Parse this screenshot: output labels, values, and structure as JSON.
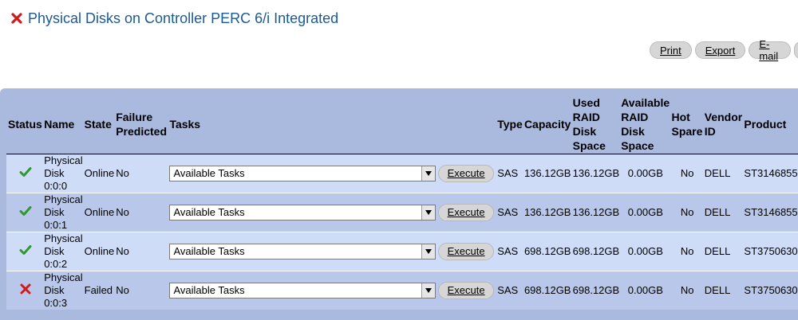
{
  "header": {
    "title": "Physical Disks on Controller PERC 6/i Integrated",
    "status_icon": "critical-x-icon"
  },
  "actions": {
    "print": "Print",
    "export": "Export",
    "email": "E-mail"
  },
  "table": {
    "columns": {
      "status": "Status",
      "name": "Name",
      "state": "State",
      "failure_predicted": "Failure Predicted",
      "tasks": "Tasks",
      "type": "Type",
      "capacity": "Capacity",
      "used_raid": "Used RAID Disk Space",
      "available_raid": "Available RAID Disk Space",
      "hot_spare": "Hot Spare",
      "vendor_id": "Vendor ID",
      "product": "Product"
    },
    "rows": [
      {
        "status": "ok",
        "name": "Physical Disk 0:0:0",
        "state": "Online",
        "failure_predicted": "No",
        "task_select": "Available Tasks",
        "execute": "Execute",
        "type": "SAS",
        "capacity": "136.12GB",
        "used_raid": "136.12GB",
        "available_raid": "0.00GB",
        "hot_spare": "No",
        "vendor_id": "DELL",
        "product": "ST3146855"
      },
      {
        "status": "ok",
        "name": "Physical Disk 0:0:1",
        "state": "Online",
        "failure_predicted": "No",
        "task_select": "Available Tasks",
        "execute": "Execute",
        "type": "SAS",
        "capacity": "136.12GB",
        "used_raid": "136.12GB",
        "available_raid": "0.00GB",
        "hot_spare": "No",
        "vendor_id": "DELL",
        "product": "ST3146855"
      },
      {
        "status": "ok",
        "name": "Physical Disk 0:0:2",
        "state": "Online",
        "failure_predicted": "No",
        "task_select": "Available Tasks",
        "execute": "Execute",
        "type": "SAS",
        "capacity": "698.12GB",
        "used_raid": "698.12GB",
        "available_raid": "0.00GB",
        "hot_spare": "No",
        "vendor_id": "DELL",
        "product": "ST3750630"
      },
      {
        "status": "failed",
        "name": "Physical Disk 0:0:3",
        "state": "Failed",
        "failure_predicted": "No",
        "task_select": "Available Tasks",
        "execute": "Execute",
        "type": "SAS",
        "capacity": "698.12GB",
        "used_raid": "698.12GB",
        "available_raid": "0.00GB",
        "hot_spare": "No",
        "vendor_id": "DELL",
        "product": "ST3750630"
      }
    ]
  },
  "colors": {
    "title": "#1a5a96",
    "table_bg": "#aab9de",
    "row_light": "#cfdcf8",
    "row_dark": "#b9c8ea",
    "ok_green": "#2e9a2e",
    "critical_red": "#d11a1a"
  }
}
